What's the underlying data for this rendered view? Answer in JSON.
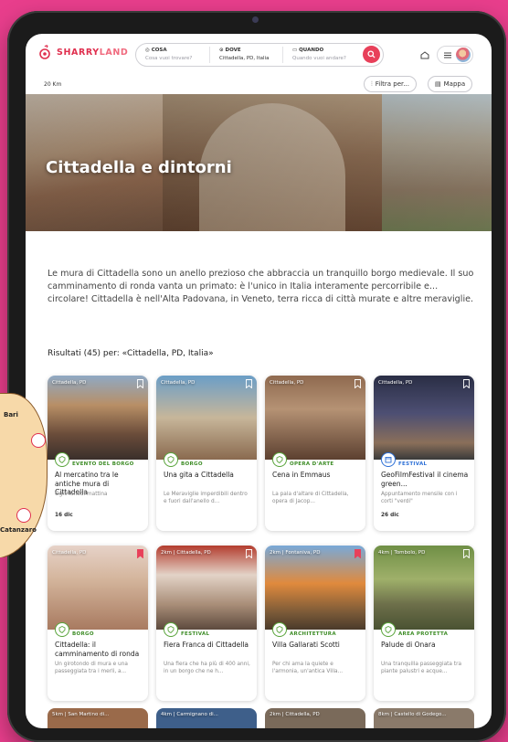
{
  "app": {
    "brand_first": "SHARRY",
    "brand_second": "LAND"
  },
  "search": {
    "what_label": "COSA",
    "what_placeholder": "Cosa vuoi trovare?",
    "where_label": "DOVE",
    "where_value": "Cittadella, PD, Italia",
    "when_label": "QUANDO",
    "when_placeholder": "Quando vuoi andare?"
  },
  "filters": {
    "radius": "20 Km",
    "filter_label": "Filtra per...",
    "map_label": "Mappa"
  },
  "hero": {
    "title": "Cittadella e dintorni"
  },
  "intro": {
    "text": "Le mura di Cittadella sono un anello prezioso che abbraccia un tranquillo borgo medievale. Il suo camminamento di ronda vanta un primato: è l'unico in Italia interamente percorribile e... circolare! Cittadella è nell'Alta Padovana, in Veneto, terra ricca di città murate e altre meraviglie."
  },
  "results": {
    "title": "Risultati (45) per: «Cittadella, PD, Italia»"
  },
  "cards": [
    {
      "location": "Cittadella, PD",
      "category": "EVENTO DEL BORGO",
      "title": "Al mercatino tra le antiche mura di Cittadella",
      "desc": "Ogni lunedì mattina",
      "date": "16 dic",
      "icon": "shield-icon",
      "bookmarked": false
    },
    {
      "location": "Cittadella, PD",
      "category": "BORGO",
      "title": "Una gita a Cittadella",
      "desc": "Le Meraviglie imperdibili dentro e fuori dall'anello d...",
      "date": "",
      "icon": "shield-icon",
      "bookmarked": false
    },
    {
      "location": "Cittadella, PD",
      "category": "OPERA D'ARTE",
      "title": "Cena in Emmaus",
      "desc": "La pala d'altare di Cittadella, opera di Jacop...",
      "date": "",
      "icon": "shield-icon",
      "bookmarked": false
    },
    {
      "location": "Cittadella, PD",
      "category": "FESTIVAL",
      "title": "GeoFilmFestival il cinema green...",
      "desc": "Appuntamento mensile con i corti \"verdi\"",
      "date": "26 dic",
      "icon": "calendar-icon",
      "bookmarked": false
    },
    {
      "location": "Cittadella, PD",
      "category": "BORGO",
      "title": "Cittadella: il camminamento di ronda",
      "desc": "Un girotondo di mura e una passeggiata tra i merli, a...",
      "date": "",
      "icon": "shield-icon",
      "bookmarked": true
    },
    {
      "location": "2km | Cittadella, PD",
      "category": "FESTIVAL",
      "title": "Fiera Franca di Cittadella",
      "desc": "Una fiera che ha più di 400 anni, in un borgo che ne h...",
      "date": "",
      "icon": "shield-icon",
      "bookmarked": false
    },
    {
      "location": "2km | Fontaniva, PD",
      "category": "ARCHITETTURA",
      "title": "Villa Gallarati Scotti",
      "desc": "Per chi ama la quiete e l'armonia, un'antica Villa...",
      "date": "",
      "icon": "shield-icon",
      "bookmarked": true
    },
    {
      "location": "4km | Tombolo, PD",
      "category": "AREA PROTETTA",
      "title": "Palude di Onara",
      "desc": "Una tranquilla passeggiata tra piante palustri e acque...",
      "date": "",
      "icon": "shield-icon",
      "bookmarked": false
    }
  ],
  "partial_cards": [
    {
      "location": "5km | San Martino di..."
    },
    {
      "location": "4km | Carmignano di..."
    },
    {
      "location": "2km | Cittadella, PD"
    },
    {
      "location": "8km | Castello di Godego..."
    }
  ],
  "map_overlay": {
    "label_top": "Bari",
    "label_bottom": "Catanzaro"
  },
  "colors": {
    "brand": "#e0304f",
    "green_category": "#3d8c26",
    "blue_category": "#2c6fd6",
    "background": "#e83e8c"
  }
}
